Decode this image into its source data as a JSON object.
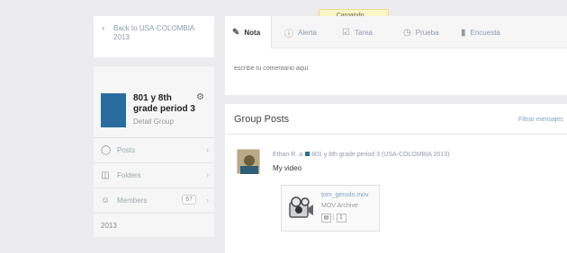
{
  "loading": {
    "text": "Cargando ..."
  },
  "sidebar": {
    "back_label": "Back to USA-COLOMBIA 2013",
    "group_name": "801 y 8th grade period 3",
    "group_sub": "Detail Group",
    "nav": [
      {
        "label": "Posts",
        "icon": "chat-bubble-icon"
      },
      {
        "label": "Folders",
        "icon": "folder-icon"
      },
      {
        "label": "Members",
        "icon": "members-icon",
        "count": "67"
      }
    ],
    "year": "2013"
  },
  "composer": {
    "tabs": [
      {
        "label": "Nota",
        "icon": "note-icon",
        "active": true
      },
      {
        "label": "Alerta",
        "icon": "alert-icon"
      },
      {
        "label": "Tarea",
        "icon": "assignment-icon"
      },
      {
        "label": "Prueba",
        "icon": "quiz-icon"
      },
      {
        "label": "Encuesta",
        "icon": "poll-icon"
      }
    ],
    "placeholder": "escribe tu comentario aquí"
  },
  "posts": {
    "title": "Group Posts",
    "filter_label": "Filtrar mensajes",
    "items": [
      {
        "author": "Ethan R.",
        "to_word": "a",
        "group": "801 y 8th grade period 3 (USA-COLOMBIA 2013)",
        "body": "My video",
        "attachment": {
          "name": "tom_gerudo.mov",
          "type": "MOV Archive",
          "sep": "|"
        }
      }
    ]
  },
  "colors": {
    "accent": "#2b6c9e",
    "link": "#7fa3c3",
    "loading_bg": "#fbf6c8"
  }
}
